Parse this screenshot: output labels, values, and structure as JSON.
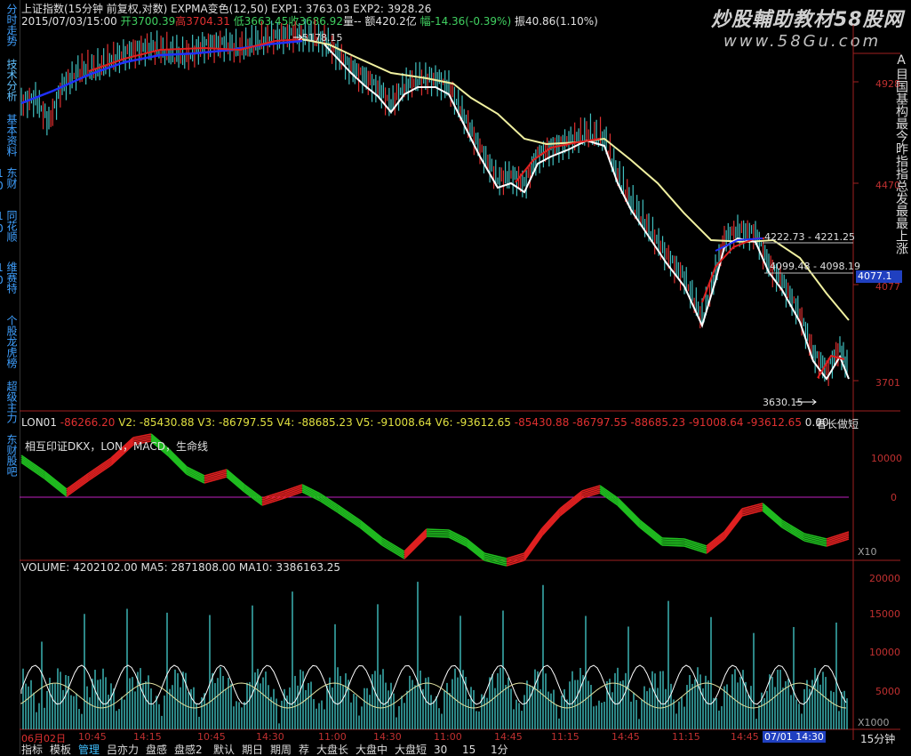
{
  "sidebar": {
    "items": [
      {
        "label": "分时走势",
        "active": false
      },
      {
        "label": "技术分析",
        "active": true
      },
      {
        "label": "基本资料",
        "active": false
      },
      {
        "label": "东财10",
        "active": false
      },
      {
        "label": "同花顺10",
        "active": false
      },
      {
        "label": "维赛特10",
        "active": false
      },
      {
        "label": "个股龙虎榜",
        "active": false
      },
      {
        "label": "超级主力",
        "active": false
      },
      {
        "label": "东财股吧",
        "active": false
      }
    ]
  },
  "main_chart": {
    "title_line": "上证指数(15分钟 前复权,对数) EXPMA变色(12,50)  EXP1: 3763.03  EXP2: 3928.26",
    "quote_date": "2015/07/03/15:00",
    "quote_open": "开3700.39",
    "quote_high": "高3704.31",
    "quote_low": "低3663.45",
    "quote_close": "收3686.92",
    "quote_vol": "量-- 额420.2亿",
    "quote_change": "幅-14.36(-0.39%)",
    "quote_amp": "振40.86(1.10%)",
    "annotations": [
      {
        "text": "5178.15"
      },
      {
        "text": "4222.73 - 4221.25"
      },
      {
        "text": "4099.48 - 4098.19"
      },
      {
        "text": "3630.15"
      }
    ],
    "price_axis": [
      "4928",
      "4470",
      "4077",
      "3701"
    ],
    "current_price": "4077.1",
    "line_colors": {
      "exp_fast": "#ffffff",
      "exp_slow": "#f0f0a0",
      "up_ma": "#e02020",
      "down_ma": "#2030ff",
      "candle_up": "#e03030",
      "candle_down": "#40c0c0"
    }
  },
  "lon_panel": {
    "header_label": "LON01",
    "header_values": [
      {
        "text": "-86266.20",
        "color": "#e03030"
      },
      {
        "text": "V2: -85430.88",
        "color": "#e0e040"
      },
      {
        "text": "V3: -86797.55",
        "color": "#e0e040"
      },
      {
        "text": "V4: -88685.23",
        "color": "#e0e040"
      },
      {
        "text": "V5: -91008.64",
        "color": "#e0e040"
      },
      {
        "text": "V6: -93612.65",
        "color": "#e0e040"
      },
      {
        "text": "-85430.88",
        "color": "#e03030"
      },
      {
        "text": "-86797.55",
        "color": "#e03030"
      },
      {
        "text": "-88685.23",
        "color": "#e03030"
      },
      {
        "text": "-91008.64",
        "color": "#e03030"
      },
      {
        "text": "-93612.65",
        "color": "#e03030"
      },
      {
        "text": "0.00",
        "color": "#e0e0e0"
      }
    ],
    "right_note": "看长做短",
    "subtitle": "相互印证DKX，LON，MACD，生命线",
    "axis": [
      "10000",
      "0",
      "X10"
    ]
  },
  "volume_panel": {
    "header": "VOLUME: 4202102.00  MA5: 2871808.00  MA10: 3386163.25",
    "axis": [
      "20000",
      "15000",
      "10000",
      "5000",
      "X1000"
    ]
  },
  "time_axis": {
    "labels": [
      "06月02日",
      "10:45",
      "14:15",
      "10:45",
      "14:30",
      "11:00",
      "14:30",
      "11:00",
      "14:45",
      "11:15",
      "14:45",
      "11:15",
      "14:45",
      "07/01 14:30"
    ],
    "period": "15分钟"
  },
  "bottom_tabs": [
    "指标",
    "模板",
    "管理",
    "吕亦力",
    "盘感",
    "盘感2",
    "默认",
    "期日",
    "期周",
    "荐",
    "大盘长",
    "大盘中",
    "大盘短",
    "30",
    "15",
    "1分"
  ],
  "watermark": {
    "title": "炒股輔助教材58股网",
    "url": "www.58Gu.com"
  },
  "right_edge_chars": "A目国基构最今昨指指总发最最上涨"
}
